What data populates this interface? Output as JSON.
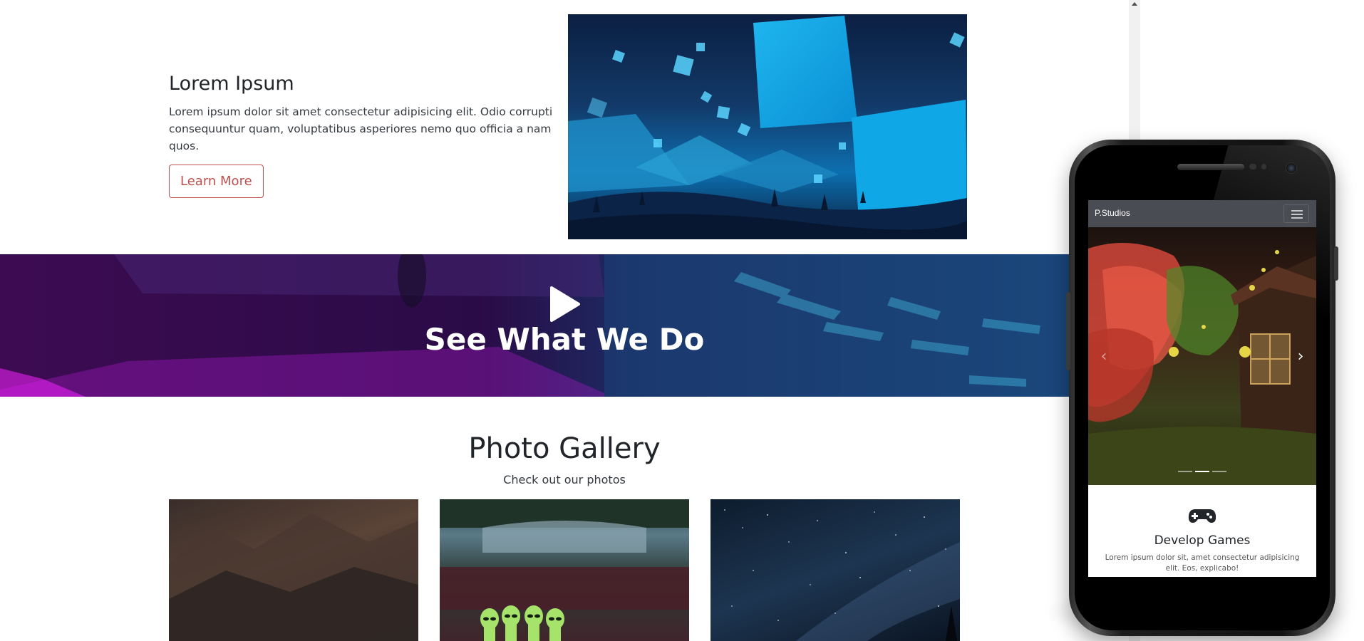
{
  "feature": {
    "title": "Lorem Ipsum",
    "description": "Lorem ipsum dolor sit amet consectetur adipisicing elit. Odio corrupti consequuntur quam, voluptatibus asperiores nemo quo officia a nam quos.",
    "button_label": "Learn More",
    "image_icon": "abstract-cubes-image"
  },
  "banner": {
    "title": "See What We Do",
    "play_icon": "play-icon"
  },
  "gallery": {
    "title": "Photo Gallery",
    "subtitle": "Check out our photos",
    "photos": [
      "mountain-photo",
      "aliens-restaurant-photo",
      "night-sky-photo"
    ]
  },
  "phone": {
    "navbar": {
      "brand": "P.Studios",
      "menu_icon": "hamburger-menu-icon"
    },
    "carousel": {
      "prev_icon": "chevron-left-icon",
      "next_icon": "chevron-right-icon",
      "slide_count": 3,
      "active_slide": 2
    },
    "service": {
      "icon": "gamepad-icon",
      "title": "Develop Games",
      "description": "Lorem ipsum dolor sit, amet consectetur adipisicing elit. Eos, explicabo!"
    }
  },
  "colors": {
    "accent": "#c0504d",
    "navbar": "#494c52",
    "banner_purple": "#3d0b52",
    "banner_blue": "#1a4c80"
  }
}
